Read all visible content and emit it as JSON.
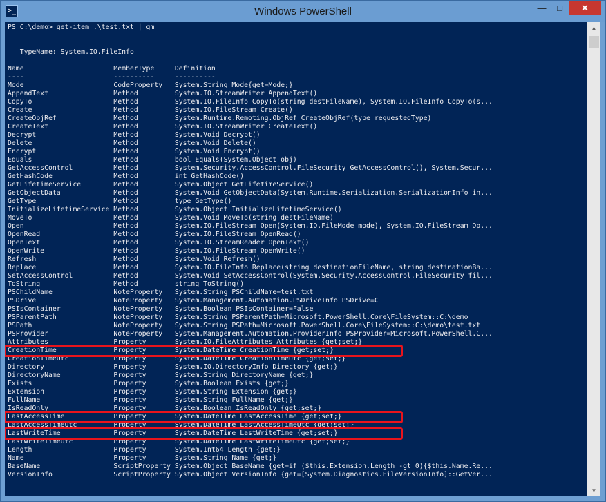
{
  "window": {
    "title": "Windows PowerShell",
    "icon_glyph": ">_",
    "controls": {
      "minimize": "—",
      "maximize": "□",
      "close": "✕"
    }
  },
  "console": {
    "colors": {
      "background": "#012456",
      "foreground": "#eeedf0",
      "highlight": "#e8141c"
    },
    "prompt": "PS C:\\demo> get-item .\\test.txt | gm",
    "typename": "   TypeName: System.IO.FileInfo",
    "header": "Name                      MemberType     Definition",
    "separator": "----                      ----------     ----------",
    "rows": [
      "Mode                      CodeProperty   System.String Mode{get=Mode;}",
      "AppendText                Method         System.IO.StreamWriter AppendText()",
      "CopyTo                    Method         System.IO.FileInfo CopyTo(string destFileName), System.IO.FileInfo CopyTo(s...",
      "Create                    Method         System.IO.FileStream Create()",
      "CreateObjRef              Method         System.Runtime.Remoting.ObjRef CreateObjRef(type requestedType)",
      "CreateText                Method         System.IO.StreamWriter CreateText()",
      "Decrypt                   Method         System.Void Decrypt()",
      "Delete                    Method         System.Void Delete()",
      "Encrypt                   Method         System.Void Encrypt()",
      "Equals                    Method         bool Equals(System.Object obj)",
      "GetAccessControl          Method         System.Security.AccessControl.FileSecurity GetAccessControl(), System.Secur...",
      "GetHashCode               Method         int GetHashCode()",
      "GetLifetimeService        Method         System.Object GetLifetimeService()",
      "GetObjectData             Method         System.Void GetObjectData(System.Runtime.Serialization.SerializationInfo in...",
      "GetType                   Method         type GetType()",
      "InitializeLifetimeService Method         System.Object InitializeLifetimeService()",
      "MoveTo                    Method         System.Void MoveTo(string destFileName)",
      "Open                      Method         System.IO.FileStream Open(System.IO.FileMode mode), System.IO.FileStream Op...",
      "OpenRead                  Method         System.IO.FileStream OpenRead()",
      "OpenText                  Method         System.IO.StreamReader OpenText()",
      "OpenWrite                 Method         System.IO.FileStream OpenWrite()",
      "Refresh                   Method         System.Void Refresh()",
      "Replace                   Method         System.IO.FileInfo Replace(string destinationFileName, string destinationBa...",
      "SetAccessControl          Method         System.Void SetAccessControl(System.Security.AccessControl.FileSecurity fil...",
      "ToString                  Method         string ToString()",
      "PSChildName               NoteProperty   System.String PSChildName=test.txt",
      "PSDrive                   NoteProperty   System.Management.Automation.PSDriveInfo PSDrive=C",
      "PSIsContainer             NoteProperty   System.Boolean PSIsContainer=False",
      "PSParentPath              NoteProperty   System.String PSParentPath=Microsoft.PowerShell.Core\\FileSystem::C:\\demo",
      "PSPath                    NoteProperty   System.String PSPath=Microsoft.PowerShell.Core\\FileSystem::C:\\demo\\test.txt",
      "PSProvider                NoteProperty   System.Management.Automation.ProviderInfo PSProvider=Microsoft.PowerShell.C...",
      "Attributes                Property       System.IO.FileAttributes Attributes {get;set;}",
      "CreationTime              Property       System.DateTime CreationTime {get;set;}",
      "CreationTimeUtc           Property       System.DateTime CreationTimeUtc {get;set;}",
      "Directory                 Property       System.IO.DirectoryInfo Directory {get;}",
      "DirectoryName             Property       System.String DirectoryName {get;}",
      "Exists                    Property       System.Boolean Exists {get;}",
      "Extension                 Property       System.String Extension {get;}",
      "FullName                  Property       System.String FullName {get;}",
      "IsReadOnly                Property       System.Boolean IsReadOnly {get;set;}",
      "LastAccessTime            Property       System.DateTime LastAccessTime {get;set;}",
      "LastAccessTimeUtc         Property       System.DateTime LastAccessTimeUtc {get;set;}",
      "LastWriteTime             Property       System.DateTime LastWriteTime {get;set;}",
      "LastWriteTimeUtc          Property       System.DateTime LastWriteTimeUtc {get;set;}",
      "Length                    Property       System.Int64 Length {get;}",
      "Name                      Property       System.String Name {get;}",
      "BaseName                  ScriptProperty System.Object BaseName {get=if ($this.Extension.Length -gt 0){$this.Name.Re...",
      "VersionInfo               ScriptProperty System.Object VersionInfo {get=[System.Diagnostics.FileVersionInfo]::GetVer..."
    ]
  }
}
